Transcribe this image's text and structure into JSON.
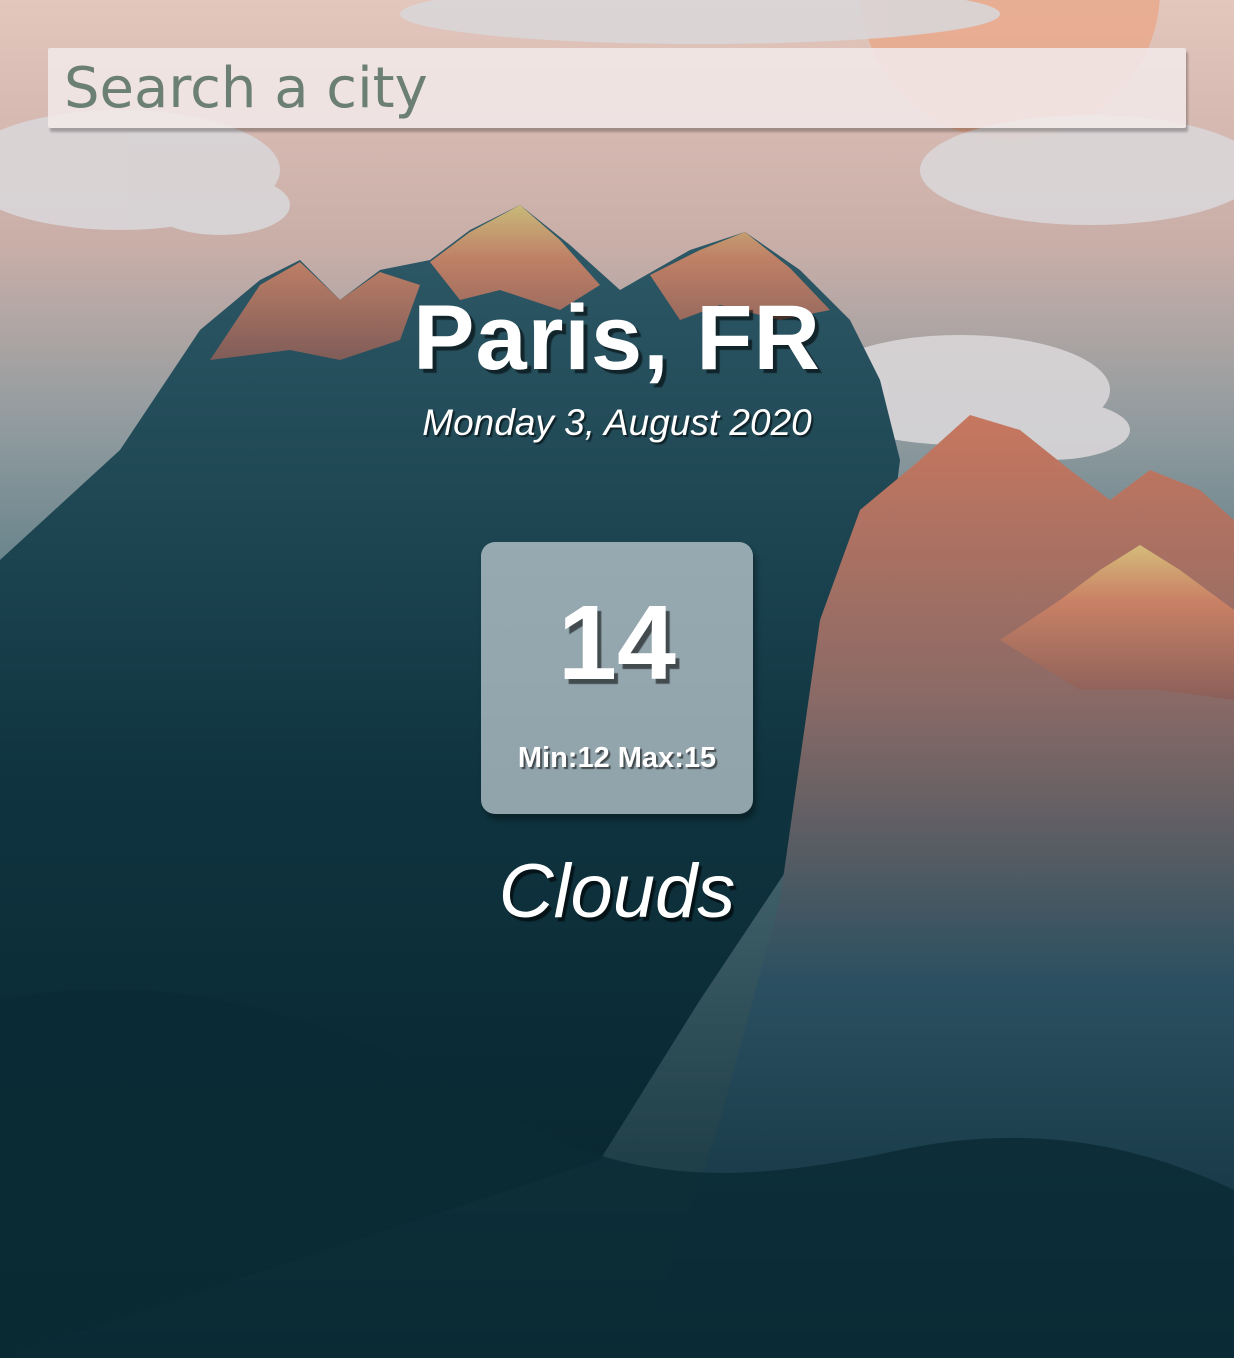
{
  "search": {
    "placeholder": "Search a city",
    "value": ""
  },
  "location": {
    "city": "Paris, FR",
    "date": "Monday 3, August 2020"
  },
  "weather": {
    "temperature": "14",
    "range_text": "Min:12 Max:15",
    "condition": "Clouds"
  },
  "colors": {
    "sky_top": "#e6c8bc",
    "mountain_dark": "#0d2e38",
    "peak_orange": "#c97a5e",
    "peak_yellow": "#d8c27a"
  }
}
